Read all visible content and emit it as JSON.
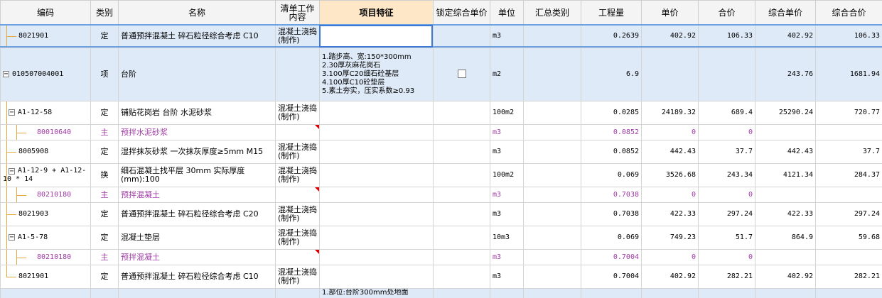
{
  "headers": {
    "code": "编码",
    "type": "类别",
    "name": "名称",
    "work": "清单工作内容",
    "feature": "项目特征",
    "lock": "锁定综合单价",
    "unit": "单位",
    "summary": "汇总类别",
    "qty": "工程量",
    "price": "单价",
    "total": "合价",
    "comp_price": "综合单价",
    "comp_total": "综合合价"
  },
  "rows": [
    {
      "code": "8021901",
      "type": "定",
      "name": "普通预拌混凝土 碎石粒径综合考虑 C10",
      "work": "混凝土浇捣(制作)",
      "feature": "",
      "unit": "m3",
      "qty": "0.2639",
      "price": "402.92",
      "total": "106.33",
      "comp_price": "402.92",
      "comp_total": "106.33"
    },
    {
      "code": "010507004001",
      "type": "项",
      "name": "台阶",
      "work": "",
      "feature": "1.踏步高、宽:150*300mm\n2.30厚灰麻花岗石\n3.100厚C20细石砼基层\n4.100厚C10砼垫层\n5.素土夯实，压实系数≥0.93",
      "unit": "m2",
      "qty": "6.9",
      "price": "",
      "total": "",
      "comp_price": "243.76",
      "comp_total": "1681.94"
    },
    {
      "code": "A1-12-58",
      "type": "定",
      "name": "铺贴花岗岩 台阶 水泥砂浆",
      "work": "混凝土浇捣(制作)",
      "feature": "",
      "unit": "100m2",
      "qty": "0.0285",
      "price": "24189.32",
      "total": "689.4",
      "comp_price": "25290.24",
      "comp_total": "720.77"
    },
    {
      "code": "80010640",
      "type": "主",
      "name": "预拌水泥砂浆",
      "work": "",
      "feature": "",
      "unit": "m3",
      "qty": "0.0852",
      "price": "0",
      "total": "0",
      "comp_price": "",
      "comp_total": ""
    },
    {
      "code": "8005908",
      "type": "定",
      "name": "湿拌抹灰砂浆 一次抹灰厚度≥5mm M15",
      "work": "混凝土浇捣(制作)",
      "feature": "",
      "unit": "m3",
      "qty": "0.0852",
      "price": "442.43",
      "total": "37.7",
      "comp_price": "442.43",
      "comp_total": "37.7"
    },
    {
      "code": "A1-12-9 + A1-12-10 * 14",
      "type": "换",
      "name": "细石混凝土找平层 30mm  实际厚度(mm):100",
      "work": "混凝土浇捣(制作)",
      "feature": "",
      "unit": "100m2",
      "qty": "0.069",
      "price": "3526.68",
      "total": "243.34",
      "comp_price": "4121.34",
      "comp_total": "284.37"
    },
    {
      "code": "80210180",
      "type": "主",
      "name": "预拌混凝土",
      "work": "",
      "feature": "",
      "unit": "m3",
      "qty": "0.7038",
      "price": "0",
      "total": "0",
      "comp_price": "",
      "comp_total": ""
    },
    {
      "code": "8021903",
      "type": "定",
      "name": "普通预拌混凝土 碎石粒径综合考虑 C20",
      "work": "混凝土浇捣(制作)",
      "feature": "",
      "unit": "m3",
      "qty": "0.7038",
      "price": "422.33",
      "total": "297.24",
      "comp_price": "422.33",
      "comp_total": "297.24"
    },
    {
      "code": "A1-5-78",
      "type": "定",
      "name": "混凝土垫层",
      "work": "混凝土浇捣(制作)",
      "feature": "",
      "unit": "10m3",
      "qty": "0.069",
      "price": "749.23",
      "total": "51.7",
      "comp_price": "864.9",
      "comp_total": "59.68"
    },
    {
      "code": "80210180",
      "type": "主",
      "name": "预拌混凝土",
      "work": "",
      "feature": "",
      "unit": "m3",
      "qty": "0.7004",
      "price": "0",
      "total": "0",
      "comp_price": "",
      "comp_total": ""
    },
    {
      "code": "8021901",
      "type": "定",
      "name": "普通预拌混凝土 碎石粒径综合考虑 C10",
      "work": "混凝土浇捣(制作)",
      "feature": "",
      "unit": "m3",
      "qty": "0.7004",
      "price": "402.92",
      "total": "282.21",
      "comp_price": "402.92",
      "comp_total": "282.21"
    },
    {
      "code": "",
      "type": "",
      "name": "",
      "work": "",
      "feature": "1.部位:台阶300mm处地面",
      "unit": "",
      "qty": "",
      "price": "",
      "total": "",
      "comp_price": "",
      "comp_total": ""
    }
  ],
  "colors": {
    "header_bg": "#f4f4f4",
    "feature_header_bg": "#fde7c6",
    "selected_bg": "#dfeaf8",
    "main_material": "#a03aa6",
    "tree_line": "#e3a83a",
    "focus_border": "#3a79d6"
  },
  "icons": {
    "collapse": "minus-box-icon",
    "comment": "red-corner-triangle-icon"
  }
}
